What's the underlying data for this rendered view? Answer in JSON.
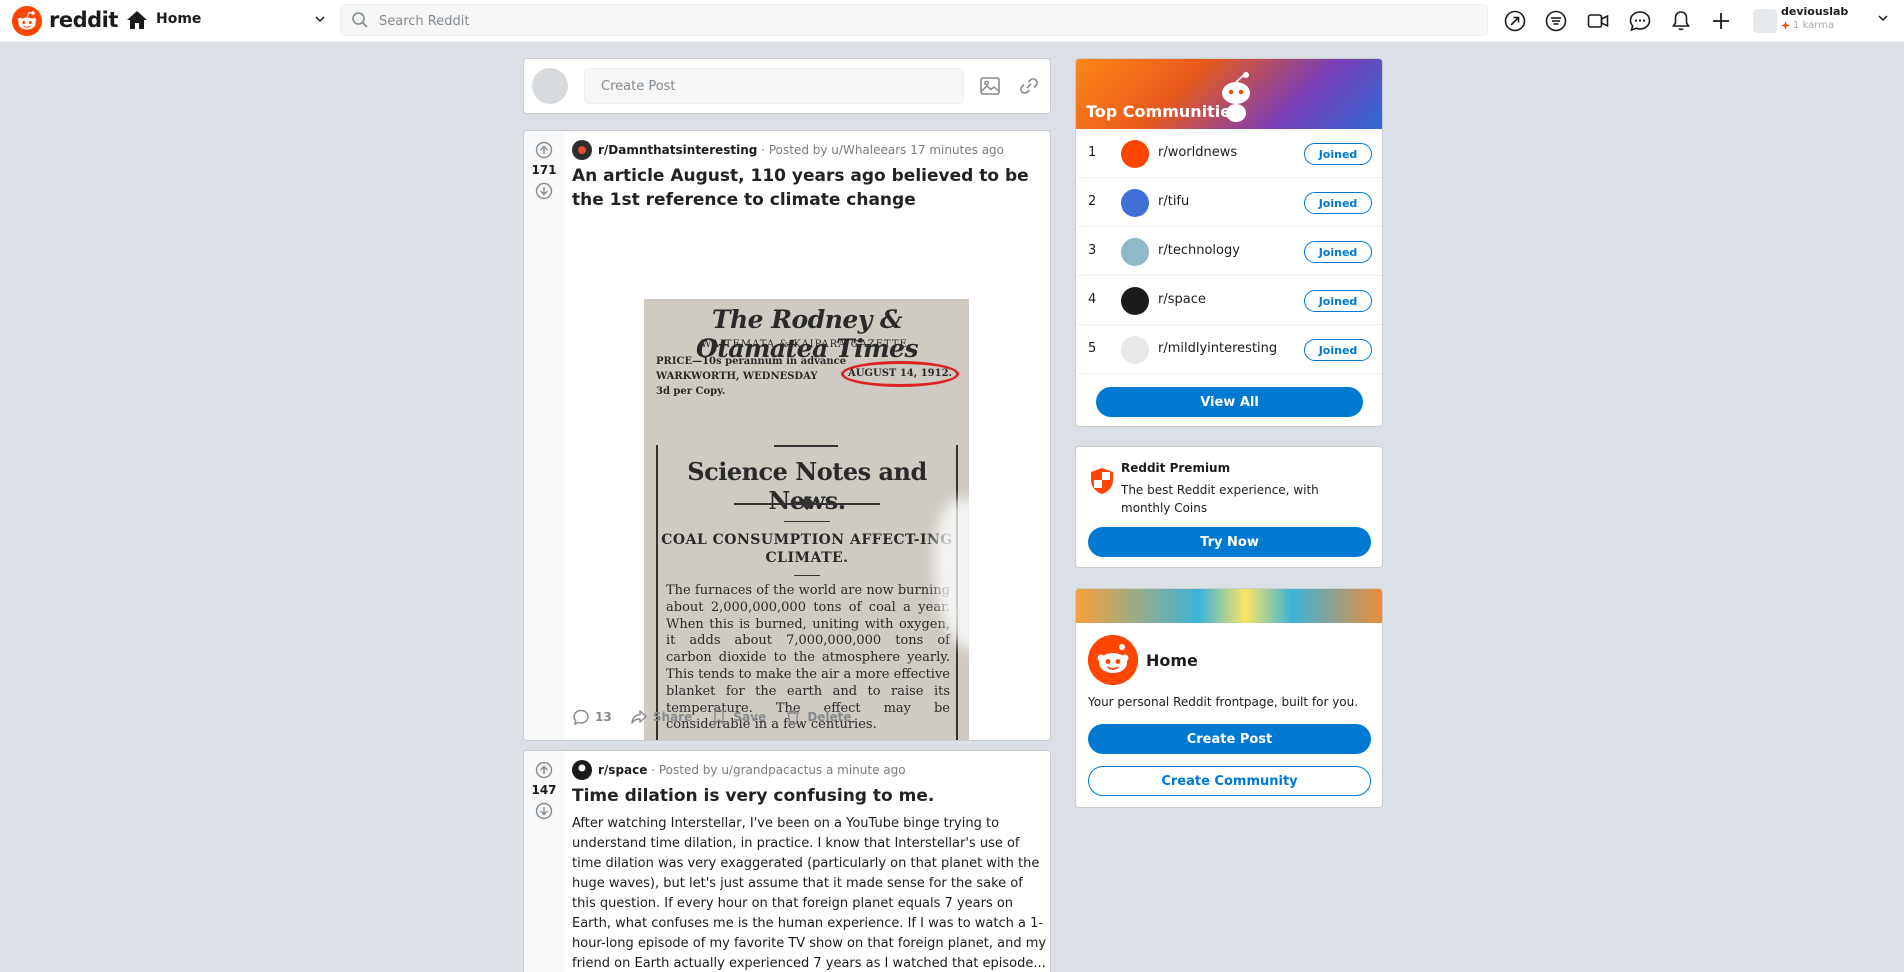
{
  "header": {
    "brand": "reddit",
    "nav_label": "Home",
    "search_placeholder": "Search Reddit",
    "user": {
      "name": "deviouslab",
      "karma": "1 karma"
    },
    "icons": [
      "popular-icon",
      "feed-icon",
      "video-icon",
      "chat-icon",
      "notification-icon",
      "plus-icon"
    ]
  },
  "create_post": {
    "placeholder": "Create Post"
  },
  "posts": [
    {
      "score": "171",
      "subreddit": "r/Damnthatsinteresting",
      "posted": "Posted by u/Whaleears 17 minutes ago",
      "title": "An article August, 110 years ago believed to be the 1st reference to climate change",
      "image": {
        "masthead": "The Rodney & Otamatea Times",
        "gazette": "WAITEMATA & KAIPARA GAZETTE.",
        "price": "PRICE—10s perannum in advance",
        "location": "WARKWORTH, WEDNESDAY",
        "date": "AUGUST 14, 1912.",
        "copy": "3d per Copy.",
        "headline": "Science Notes and News.",
        "subheadline": "COAL CONSUMPTION AFFECT-ING CLIMATE.",
        "text": "The furnaces of the world are now burning about 2,000,000,000 tons of coal a year. When this is burned, uniting with oxygen, it adds about 7,000,000,000 tons of carbon dioxide to the atmosphere yearly. This tends to make the air a more effective blanket for the earth and to raise its temperature. The effect may be considerable in a few centuries."
      },
      "comments": "13",
      "share": "Share",
      "save": "Save",
      "delete": "Delete"
    },
    {
      "score": "147",
      "subreddit": "r/space",
      "posted": "Posted by u/grandpacactus a minute ago",
      "title": "Time dilation is very confusing to me.",
      "body": "After watching Interstellar, I've been on a YouTube binge trying to understand time dilation, in practice. I know that Interstellar's use of time dilation was very exaggerated (particularly on that planet with the huge waves), but let's just assume that it made sense for the sake of this question. If every hour on that foreign planet equals 7 years on Earth, what confuses me is the human experience. If I was to watch a 1-hour-long episode of my favorite TV show on that foreign planet, and my friend on Earth actually experienced 7 years as I watched that episode... does that"
    }
  ],
  "top_communities": {
    "title": "Top Communities",
    "items": [
      {
        "rank": "1",
        "name": "r/worldnews",
        "button": "Joined",
        "color": "#ff4500"
      },
      {
        "rank": "2",
        "name": "r/tifu",
        "button": "Joined",
        "color": "#3d6fd6"
      },
      {
        "rank": "3",
        "name": "r/technology",
        "button": "Joined",
        "color": "#8fb8c9"
      },
      {
        "rank": "4",
        "name": "r/space",
        "button": "Joined",
        "color": "#1a1a1a"
      },
      {
        "rank": "5",
        "name": "r/mildlyinteresting",
        "button": "Joined",
        "color": "#e8e8e8"
      }
    ],
    "view_all": "View All"
  },
  "premium": {
    "title": "Reddit Premium",
    "description": "The best Reddit experience, with monthly Coins",
    "button": "Try Now"
  },
  "home_card": {
    "title": "Home",
    "description": "Your personal Reddit frontpage, built for you.",
    "create_post": "Create Post",
    "create_community": "Create Community"
  },
  "colors": {
    "accent": "#0079d3",
    "brand": "#ff4500",
    "background": "#dae0e6"
  }
}
